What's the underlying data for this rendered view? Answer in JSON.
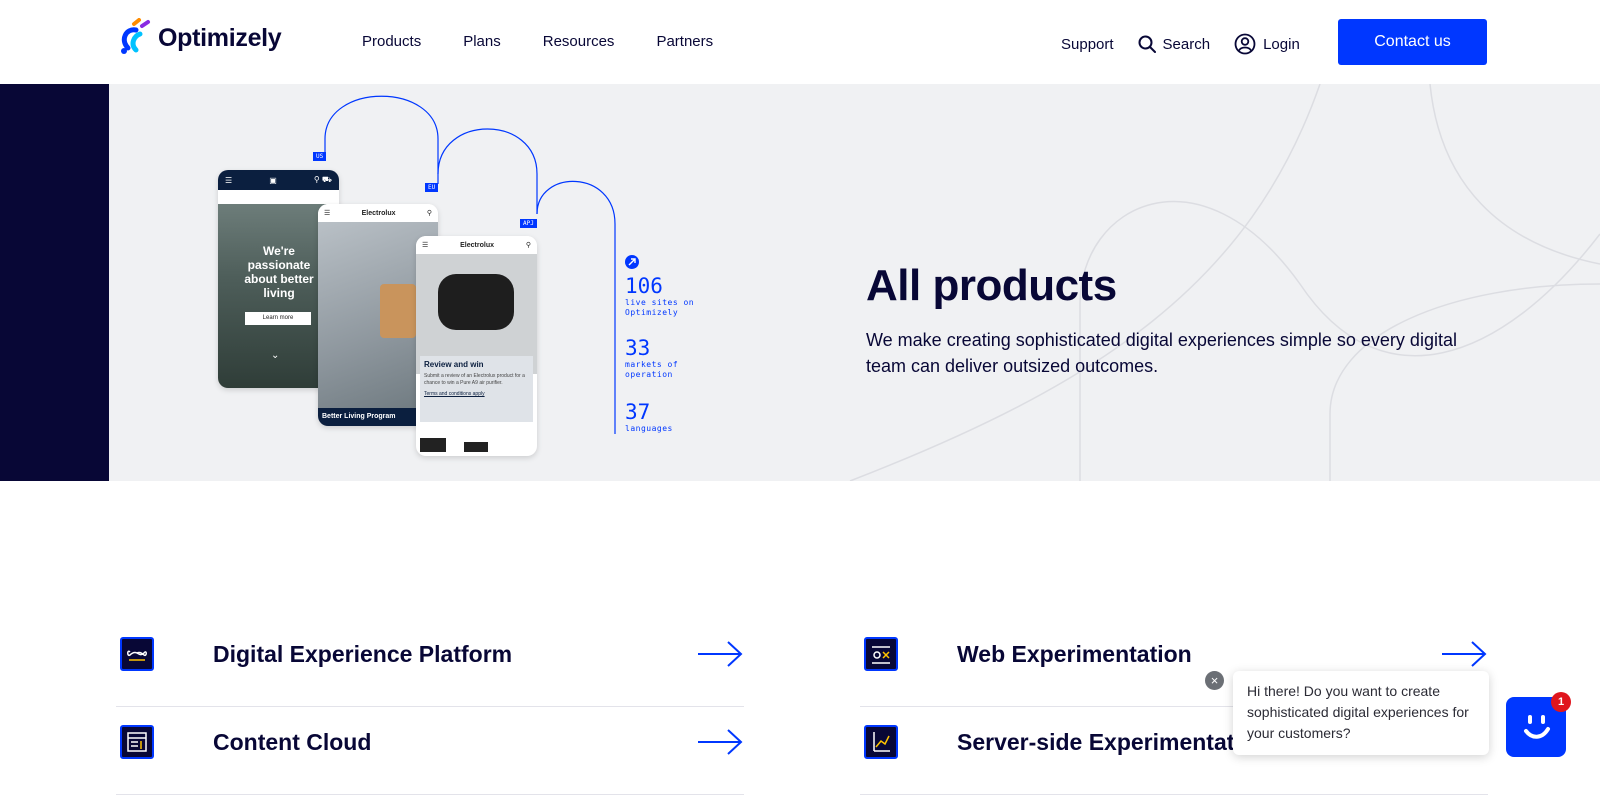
{
  "header": {
    "logo_text": "Optimizely",
    "nav": [
      "Products",
      "Plans",
      "Resources",
      "Partners"
    ],
    "support_label": "Support",
    "search_label": "Search",
    "login_label": "Login",
    "contact_label": "Contact us"
  },
  "hero": {
    "title": "All products",
    "description": "We make creating sophisticated digital experiences simple so every digital team can deliver outsized outcomes.",
    "stats": [
      {
        "num": "106",
        "label": "live sites on Optimizely"
      },
      {
        "num": "33",
        "label": "markets of operation"
      },
      {
        "num": "37",
        "label": "languages"
      }
    ],
    "region_tags": [
      "US",
      "EU",
      "APJ"
    ],
    "phone1": {
      "headline": "We're passionate about better living",
      "button": "Learn more"
    },
    "phone2": {
      "brand": "Electrolux",
      "footer": "Better Living Program"
    },
    "phone3": {
      "brand": "Electrolux",
      "card_title": "Review and win",
      "card_text": "Submit a review of an Electrolux product for a chance to win a Pure A9 air purifier.",
      "card_link": "Terms and conditions apply"
    }
  },
  "products": [
    {
      "name": "Digital Experience Platform",
      "icon": "infinity-icon"
    },
    {
      "name": "Web Experimentation",
      "icon": "ox-icon"
    },
    {
      "name": "Content Cloud",
      "icon": "layout-icon"
    },
    {
      "name": "Server-side Experimentation",
      "icon": "chart-icon"
    }
  ],
  "chat": {
    "message": "Hi there! Do you want to create sophisticated digital experiences for your customers?",
    "badge": "1",
    "close": "×"
  },
  "colors": {
    "brand": "#0037ff",
    "navy": "#080736",
    "hero_bg": "#f0f1f3"
  }
}
